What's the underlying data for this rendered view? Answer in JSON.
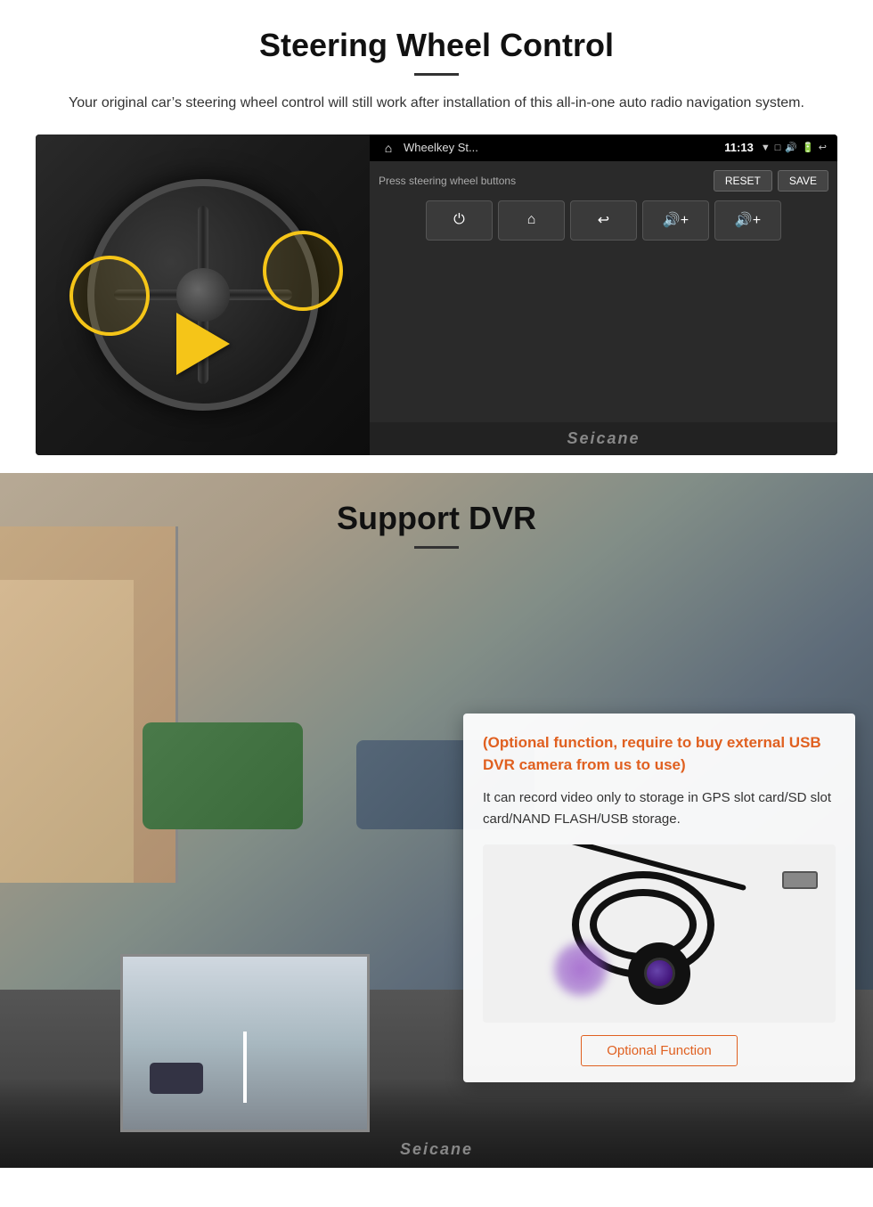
{
  "steering": {
    "title": "Steering Wheel Control",
    "subtitle": "Your original car’s steering wheel control will still work after installation of this all-in-one auto radio navigation system.",
    "android": {
      "app_name": "Wheelkey St...",
      "time": "11:13",
      "label": "Press steering wheel buttons",
      "reset_label": "RESET",
      "save_label": "SAVE",
      "buttons": [
        "⏻",
        "⌂",
        "↩",
        "🔊+",
        "🔊+"
      ]
    },
    "watermark": "Seicane"
  },
  "dvr": {
    "title": "Support DVR",
    "optional_text": "(Optional function, require to buy external USB DVR camera from us to use)",
    "description": "It can record video only to storage in GPS slot card/SD slot card/NAND FLASH/USB storage.",
    "optional_function_label": "Optional Function",
    "watermark": "Seicane"
  }
}
